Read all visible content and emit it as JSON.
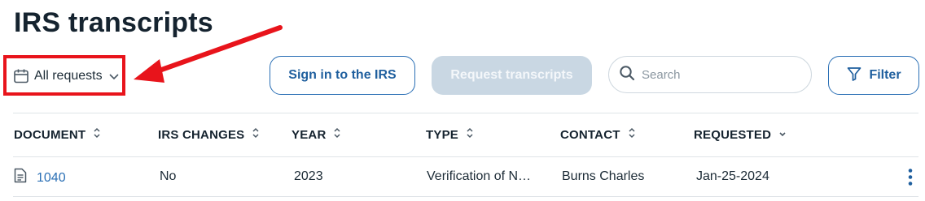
{
  "page": {
    "title": "IRS transcripts"
  },
  "toolbar": {
    "filter_label": "All requests",
    "sign_in_label": "Sign in to the IRS",
    "request_label": "Request transcripts",
    "search_placeholder": "Search",
    "filter_button_label": "Filter"
  },
  "table": {
    "columns": [
      "DOCUMENT",
      "IRS CHANGES",
      "YEAR",
      "TYPE",
      "CONTACT",
      "REQUESTED"
    ],
    "rows": [
      {
        "document": "1040",
        "irs_changes": "No",
        "year": "2023",
        "type": "Verification of N…",
        "contact": "Burns Charles",
        "requested": "Jan-25-2024"
      }
    ]
  },
  "colors": {
    "accent": "#2a6fb5",
    "annotation": "#e8141b",
    "disabled_button": "#c9d7e3"
  }
}
